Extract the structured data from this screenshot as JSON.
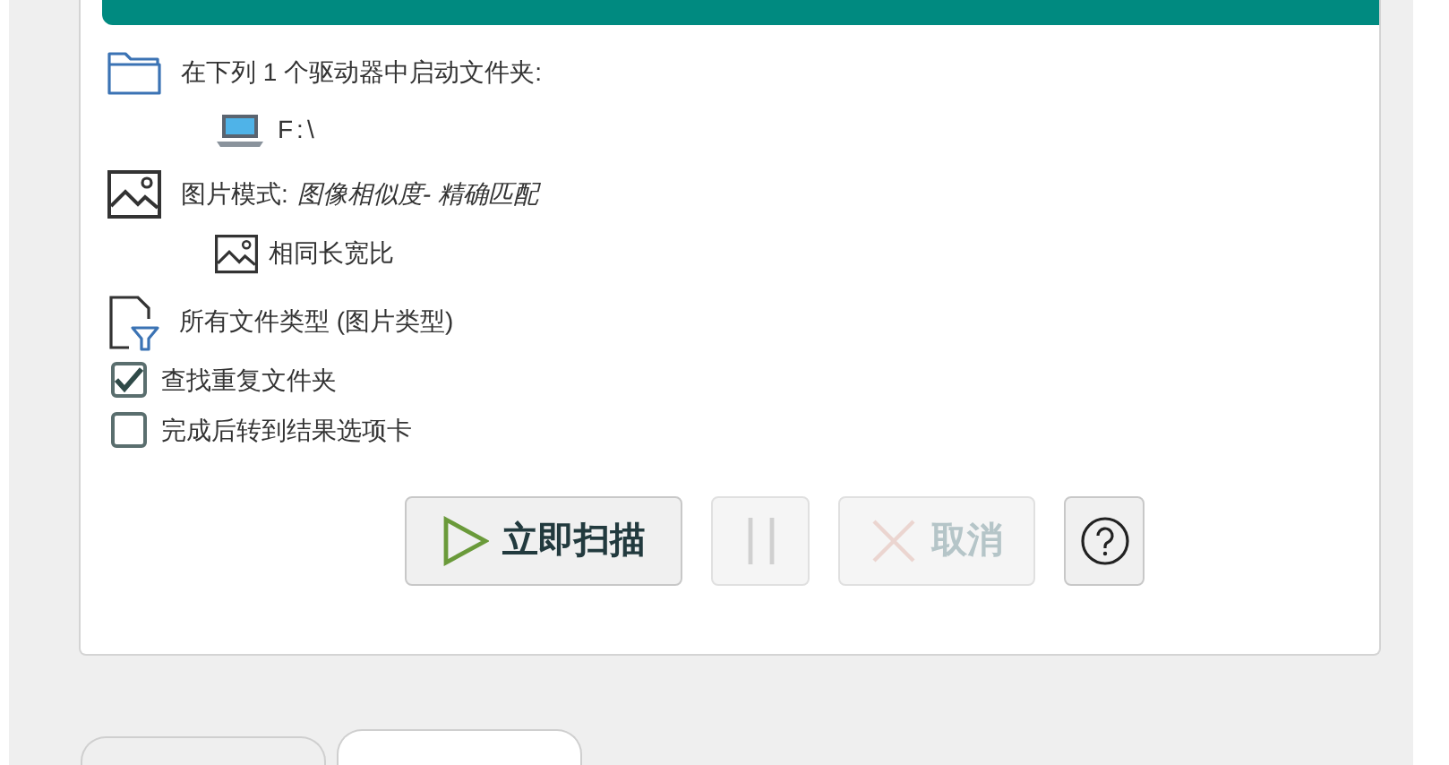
{
  "source": {
    "label": "在下列 1 个驱动器中启动文件夹:",
    "drives": [
      "F:\\"
    ]
  },
  "mode": {
    "label": "图片模式:",
    "value": "图像相似度- 精确匹配",
    "options": [
      "相同长宽比"
    ]
  },
  "file_types": "所有文件类型 (图片类型)",
  "checkboxes": [
    {
      "label": "查找重复文件夹",
      "checked": true
    },
    {
      "label": "完成后转到结果选项卡",
      "checked": false
    }
  ],
  "buttons": [
    {
      "kind": "scan",
      "label": "立即扫描",
      "disabled": false
    },
    {
      "kind": "pause",
      "disabled": true
    },
    {
      "kind": "cancel",
      "label": "取消",
      "disabled": true
    },
    {
      "kind": "help",
      "disabled": false
    }
  ],
  "bottom_tabs": [
    {
      "selected": false
    },
    {
      "selected": true
    }
  ]
}
